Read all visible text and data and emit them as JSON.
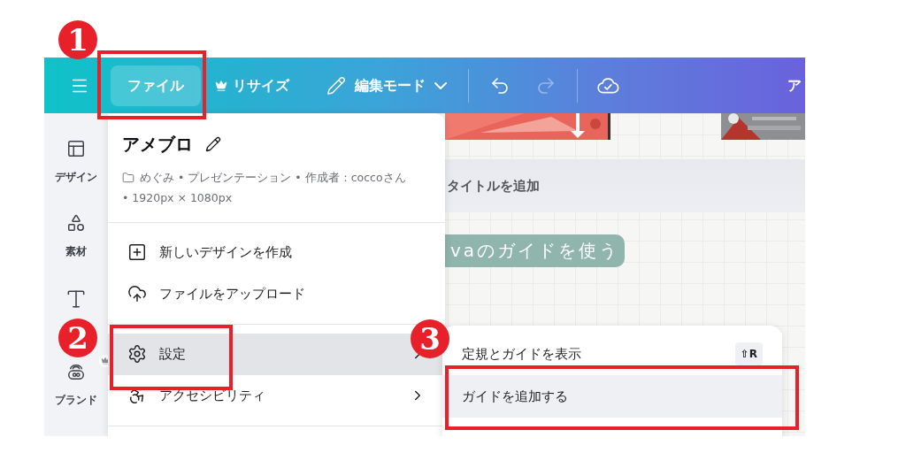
{
  "toolbar": {
    "file_button": "ファイル",
    "resize_button": "リサイズ",
    "edit_mode": "編集モード",
    "redo_disabled": true,
    "title": "ア"
  },
  "sidebar": {
    "items": [
      {
        "kind": "design",
        "label": "デザイン"
      },
      {
        "kind": "elements",
        "label": "素材"
      },
      {
        "kind": "text"
      },
      {
        "kind": "brand",
        "label": "ブランド",
        "premium": true
      }
    ]
  },
  "file_menu": {
    "title": "アメブロ",
    "meta_line_1": "めぐみ • プレゼンテーション • 作成者：coccoさん",
    "meta_line_2": "• 1920px × 1080px",
    "sections": [
      [
        {
          "kind": "new",
          "label": "新しいデザインを作成",
          "selected": false,
          "submenu": false
        },
        {
          "kind": "upload",
          "label": "ファイルをアップロード",
          "selected": false,
          "submenu": false
        }
      ],
      [
        {
          "kind": "settings",
          "label": "設定",
          "selected": true,
          "submenu": true
        },
        {
          "kind": "accessibility",
          "label": "アクセシビリティ",
          "selected": false,
          "submenu": true
        }
      ]
    ]
  },
  "settings_submenu": {
    "items": [
      {
        "label": "定規とガイドを表示",
        "shortcut": "⇧R",
        "selected": false
      },
      {
        "label": "ガイドを追加する",
        "selected": true
      }
    ]
  },
  "canvas": {
    "page_title_placeholder": "タイトルを追加",
    "heading": "vaのガイドを使う"
  },
  "annotations": [
    {
      "number": "1"
    },
    {
      "number": "2"
    },
    {
      "number": "3"
    }
  ]
}
